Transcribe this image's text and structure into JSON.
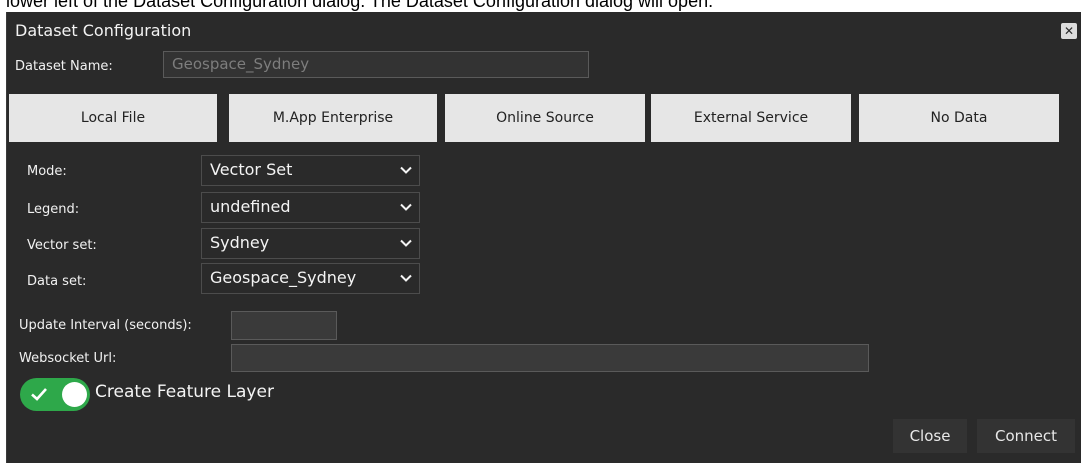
{
  "caption": "lower left of the Dataset Configuration dialog. The Dataset Configuration dialog will open.",
  "dialog": {
    "title": "Dataset Configuration",
    "close_icon": "close-icon"
  },
  "dataset_name": {
    "label": "Dataset Name:",
    "value": "Geospace_Sydney"
  },
  "source_buttons": [
    "Local File",
    "M.App Enterprise",
    "Online Source",
    "External Service",
    "No Data"
  ],
  "fields": {
    "mode": {
      "label": "Mode:",
      "value": "Vector Set"
    },
    "legend": {
      "label": "Legend:",
      "value": "undefined"
    },
    "vector_set": {
      "label": "Vector set:",
      "value": "Sydney"
    },
    "data_set": {
      "label": "Data set:",
      "value": "Geospace_Sydney"
    }
  },
  "update_interval": {
    "label": "Update Interval (seconds):",
    "value": ""
  },
  "websocket": {
    "label": "Websocket Url:",
    "value": ""
  },
  "feature_layer": {
    "label": "Create Feature Layer",
    "enabled": true
  },
  "footer": {
    "close": "Close",
    "connect": "Connect"
  },
  "colors": {
    "dialog_bg": "#2a2a2a",
    "button_bg": "#e6e6e6",
    "toggle_on": "#2ea84a"
  }
}
